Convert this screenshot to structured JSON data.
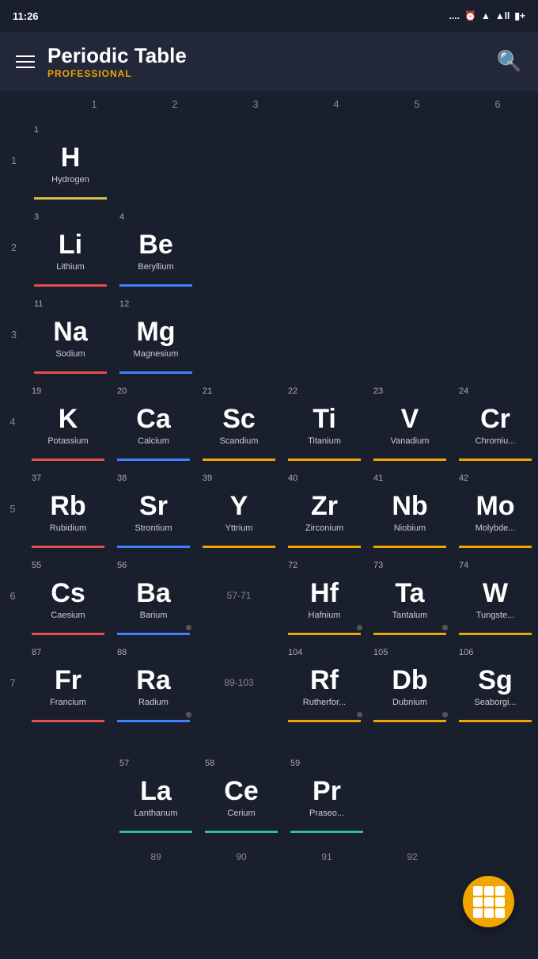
{
  "status_bar": {
    "time": "11:26",
    "signal": "....",
    "wifi": "wifi",
    "battery": "+"
  },
  "header": {
    "title": "Periodic Table",
    "subtitle": "PROFESSIONAL",
    "menu_label": "menu",
    "search_label": "search"
  },
  "col_headers": [
    "1",
    "2",
    "3",
    "4",
    "5",
    "6"
  ],
  "row_numbers": [
    "1",
    "2",
    "3",
    "4",
    "5",
    "6",
    "7"
  ],
  "elements": {
    "row1": [
      {
        "number": "1",
        "symbol": "H",
        "name": "Hydrogen",
        "underline": "yellow",
        "col": 1
      }
    ],
    "row2": [
      {
        "number": "3",
        "symbol": "Li",
        "name": "Lithium",
        "underline": "red",
        "col": 1
      },
      {
        "number": "4",
        "symbol": "Be",
        "name": "Beryllium",
        "underline": "blue",
        "col": 2
      }
    ],
    "row3": [
      {
        "number": "11",
        "symbol": "Na",
        "name": "Sodium",
        "underline": "red",
        "col": 1
      },
      {
        "number": "12",
        "symbol": "Mg",
        "name": "Magnesium",
        "underline": "blue",
        "col": 2
      }
    ],
    "row4": [
      {
        "number": "19",
        "symbol": "K",
        "name": "Potassium",
        "underline": "red",
        "col": 1
      },
      {
        "number": "20",
        "symbol": "Ca",
        "name": "Calcium",
        "underline": "blue",
        "col": 2
      },
      {
        "number": "21",
        "symbol": "Sc",
        "name": "Scandium",
        "underline": "orange",
        "col": 3
      },
      {
        "number": "22",
        "symbol": "Ti",
        "name": "Titanium",
        "underline": "orange",
        "col": 4
      },
      {
        "number": "23",
        "symbol": "V",
        "name": "Vanadium",
        "underline": "orange",
        "col": 5
      },
      {
        "number": "24",
        "symbol": "Cr",
        "name": "Chromiu...",
        "underline": "orange",
        "col": 6
      }
    ],
    "row5": [
      {
        "number": "37",
        "symbol": "Rb",
        "name": "Rubidium",
        "underline": "red",
        "col": 1
      },
      {
        "number": "38",
        "symbol": "Sr",
        "name": "Strontium",
        "underline": "blue",
        "col": 2
      },
      {
        "number": "39",
        "symbol": "Y",
        "name": "Yttrium",
        "underline": "orange",
        "col": 3
      },
      {
        "number": "40",
        "symbol": "Zr",
        "name": "Zirconium",
        "underline": "orange",
        "col": 4
      },
      {
        "number": "41",
        "symbol": "Nb",
        "name": "Niobium",
        "underline": "orange",
        "col": 5
      },
      {
        "number": "42",
        "symbol": "Mo",
        "name": "Molybde...",
        "underline": "orange",
        "col": 6
      }
    ],
    "row6": [
      {
        "number": "55",
        "symbol": "Cs",
        "name": "Caesium",
        "underline": "red",
        "col": 1
      },
      {
        "number": "56",
        "symbol": "Ba",
        "name": "Barium",
        "underline": "blue",
        "col": 2,
        "dot": true
      },
      {
        "number": "57-71",
        "symbol": "",
        "name": "",
        "underline": "",
        "col": 3,
        "gap": true
      },
      {
        "number": "72",
        "symbol": "Hf",
        "name": "Hafnium",
        "underline": "orange",
        "col": 4,
        "dot": true
      },
      {
        "number": "73",
        "symbol": "Ta",
        "name": "Tantalum",
        "underline": "orange",
        "col": 5,
        "dot": true
      },
      {
        "number": "74",
        "symbol": "W",
        "name": "Tungste...",
        "underline": "orange",
        "col": 6
      }
    ],
    "row7": [
      {
        "number": "87",
        "symbol": "Fr",
        "name": "Francium",
        "underline": "red",
        "col": 1
      },
      {
        "number": "88",
        "symbol": "Ra",
        "name": "Radium",
        "underline": "blue",
        "col": 2,
        "dot": true
      },
      {
        "number": "89-103",
        "symbol": "",
        "name": "",
        "underline": "",
        "col": 3,
        "gap": true
      },
      {
        "number": "104",
        "symbol": "Rf",
        "name": "Rutherfor...",
        "underline": "orange",
        "col": 4,
        "dot": true
      },
      {
        "number": "105",
        "symbol": "Db",
        "name": "Dubnium",
        "underline": "orange",
        "col": 5,
        "dot": true
      },
      {
        "number": "106",
        "symbol": "Sg",
        "name": "Seaborgi...",
        "underline": "orange",
        "col": 6
      }
    ]
  },
  "lanthanides": [
    {
      "number": "57",
      "symbol": "La",
      "name": "Lanthanum",
      "underline": "teal",
      "dot": false
    },
    {
      "number": "58",
      "symbol": "Ce",
      "name": "Cerium",
      "underline": "teal"
    },
    {
      "number": "59",
      "symbol": "Pr",
      "name": "Praseo...",
      "underline": "teal"
    }
  ],
  "actinides_partial": [
    {
      "number": "89",
      "symbol": "",
      "name": "",
      "underline": ""
    },
    {
      "number": "90",
      "symbol": "",
      "name": "",
      "underline": ""
    },
    {
      "number": "91",
      "symbol": "",
      "name": "",
      "underline": ""
    },
    {
      "number": "92",
      "symbol": "",
      "name": "",
      "underline": ""
    }
  ],
  "fab": {
    "label": "table-view"
  }
}
